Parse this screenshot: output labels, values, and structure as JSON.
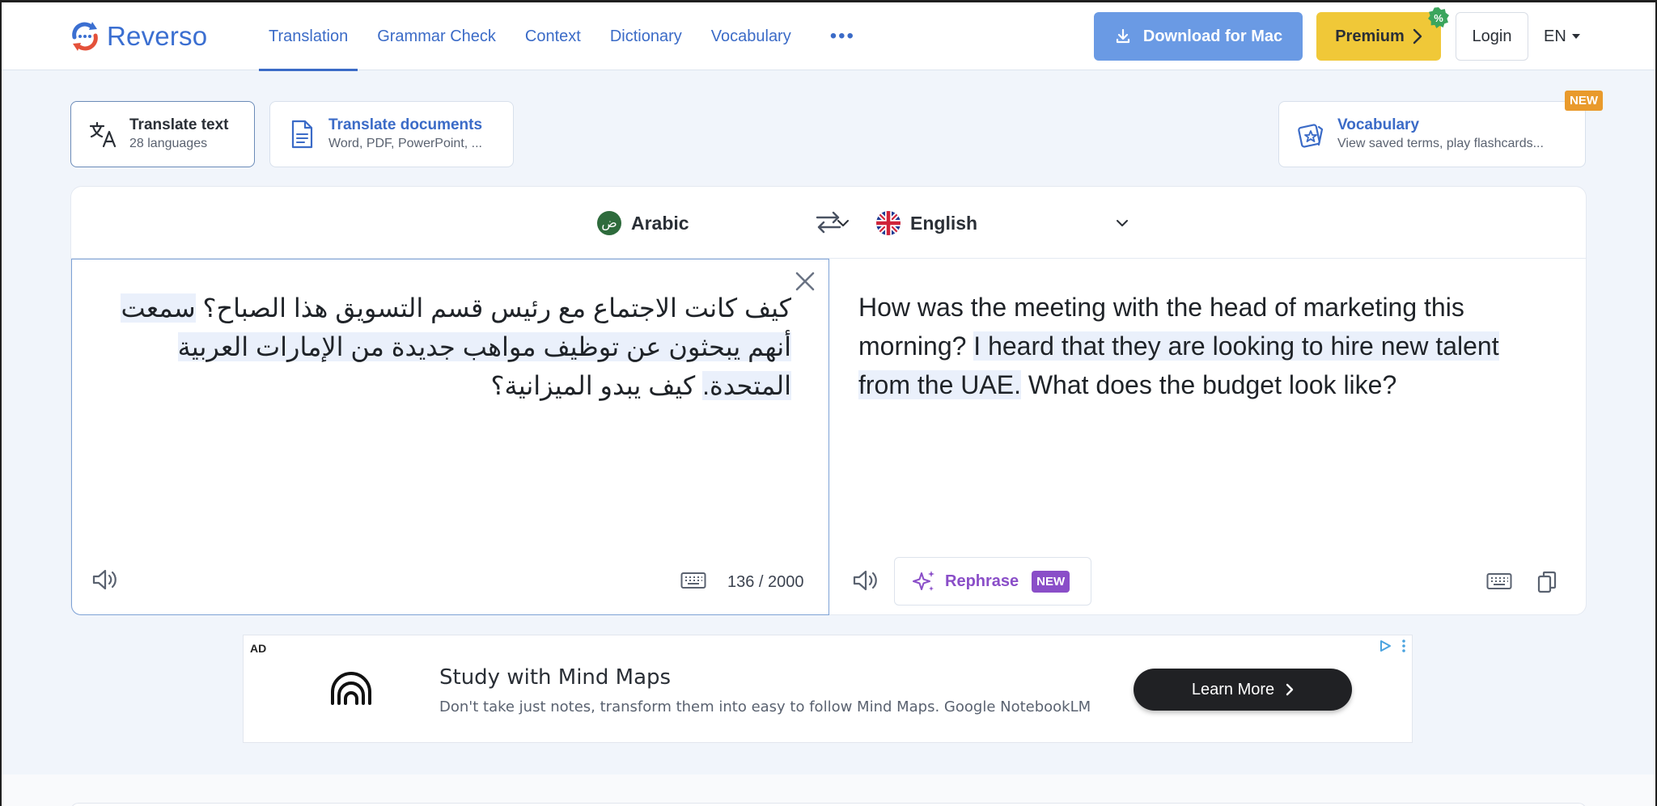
{
  "brand": {
    "name": "Reverso",
    "logo_icon": "reverso-logo-icon"
  },
  "nav": {
    "items": [
      {
        "label": "Translation",
        "active": true
      },
      {
        "label": "Grammar Check",
        "active": false
      },
      {
        "label": "Context",
        "active": false
      },
      {
        "label": "Dictionary",
        "active": false
      },
      {
        "label": "Vocabulary",
        "active": false
      }
    ],
    "more": "•••"
  },
  "header_actions": {
    "download_label": "Download for Mac",
    "premium_label": "Premium",
    "premium_badge": "%",
    "login_label": "Login",
    "ui_language": "EN"
  },
  "modes": {
    "translate_text": {
      "title": "Translate text",
      "subtitle": "28 languages"
    },
    "translate_documents": {
      "title": "Translate documents",
      "subtitle": "Word, PDF, PowerPoint, ..."
    },
    "vocabulary": {
      "title": "Vocabulary",
      "subtitle": "View saved terms, play flashcards...",
      "badge": "NEW"
    }
  },
  "translator": {
    "source_language": "Arabic",
    "source_flag_glyph": "ض",
    "target_language": "English",
    "source_text_before": "كيف كانت الاجتماع مع رئيس قسم التسويق هذا الصباح؟ ",
    "source_text_highlight": "سمعت أنهم يبحثون عن توظيف مواهب جديدة من الإمارات العربية المتحدة.",
    "source_text_after": " كيف يبدو الميزانية؟",
    "target_text_before": "How was the meeting with the head of marketing this morning? ",
    "target_text_highlight": "I heard that they are looking to hire new talent from the UAE.",
    "target_text_after": " What does the budget look like?",
    "char_count": "136 / 2000",
    "rephrase_label": "Rephrase",
    "rephrase_badge": "NEW"
  },
  "ad": {
    "tag": "AD",
    "title": "Study with Mind Maps",
    "description": "Don't take just notes, transform them into easy to follow Mind Maps. Google NotebookLM",
    "cta": "Learn More"
  },
  "colors": {
    "brand_blue": "#3b6bc7",
    "download_blue": "#6a9ae4",
    "premium_yellow": "#f0c838",
    "rephrase_purple": "#8a4ec8",
    "new_orange": "#e99a2c",
    "highlight": "#eaf0fb"
  }
}
